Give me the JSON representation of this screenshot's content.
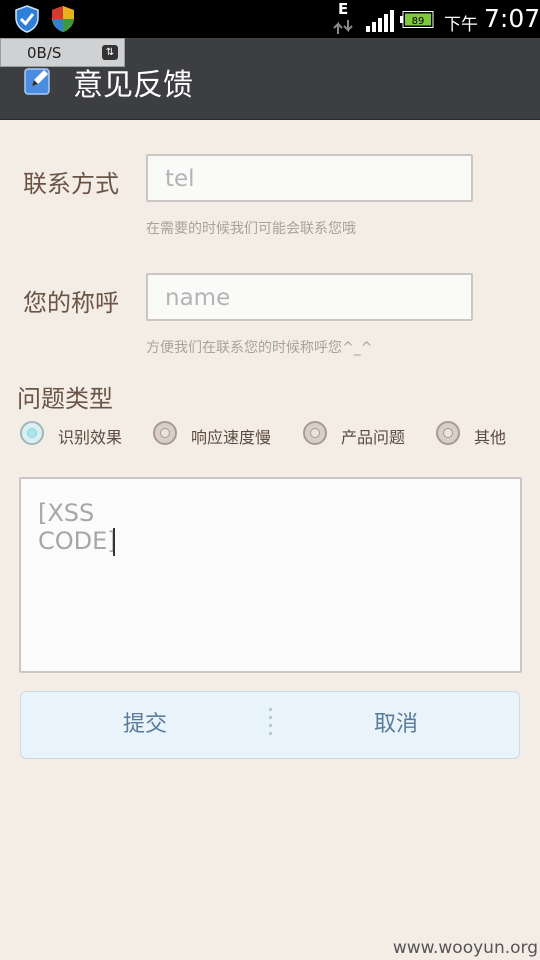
{
  "status_bar": {
    "network_type": "E",
    "battery_level": "89",
    "ampm": "下午",
    "time": "7:07",
    "icons": [
      "shield-check-icon",
      "shield-color-icon",
      "data-arrows-icon",
      "signal-bars-icon",
      "battery-icon"
    ]
  },
  "header": {
    "net_speed": "0B/S",
    "title": "意见反馈",
    "icon": "edit-pencil-icon",
    "bg_color": "#3d3e42"
  },
  "form": {
    "contact": {
      "label": "联系方式",
      "placeholder": "tel",
      "hint": "在需要的时候我们可能会联系您哦"
    },
    "name": {
      "label": "您的称呼",
      "placeholder": "name",
      "hint": "方便我们在联系您的时候称呼您^_^"
    },
    "problem_type": {
      "label": "问题类型",
      "options": [
        "识别效果",
        "响应速度慢",
        "产品问题",
        "其他"
      ],
      "selected": "识别效果"
    },
    "feedback": {
      "value": "[XSS CODE]"
    }
  },
  "buttons": {
    "submit": "提交",
    "cancel": "取消"
  },
  "watermark": "www.wooyun.org",
  "colors": {
    "background": "#f4ede6",
    "label": "#6a5446",
    "button_text": "#5b7b9b",
    "button_bg": "#e9f3fa"
  }
}
